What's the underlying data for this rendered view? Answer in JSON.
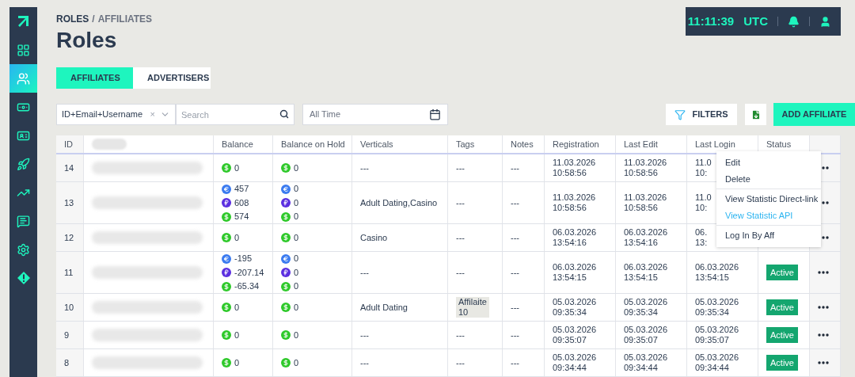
{
  "sidebar": {
    "items": [
      {
        "kind": "dashboard",
        "selected": false
      },
      {
        "kind": "users",
        "selected": true
      },
      {
        "kind": "money",
        "selected": false
      },
      {
        "kind": "card",
        "selected": false
      },
      {
        "kind": "rocket",
        "selected": false
      },
      {
        "kind": "chart",
        "selected": false
      },
      {
        "kind": "message",
        "selected": false
      },
      {
        "kind": "settings",
        "selected": false
      },
      {
        "kind": "alert",
        "selected": false
      }
    ]
  },
  "breadcrumb": {
    "parent": "ROLES",
    "separator": "/",
    "current": "AFFILIATES"
  },
  "title": "Roles",
  "topbar": {
    "time": "11:11:39",
    "zone": "UTC"
  },
  "tabs": [
    {
      "label": "AFFILIATES",
      "selected": true
    },
    {
      "label": "ADVERTISERS",
      "selected": false
    }
  ],
  "search_by": {
    "value": "ID+Email+Username",
    "clear": "×"
  },
  "search": {
    "placeholder": "Search"
  },
  "period": {
    "value": "All Time"
  },
  "filters_button": "FILTERS",
  "add_button": "ADD AFFILIATE",
  "table": {
    "columns": [
      "ID",
      "Balance",
      "Balance on Hold",
      "Verticals",
      "Tags",
      "Notes",
      "Registration",
      "Last Edit",
      "Last Login",
      "Status"
    ],
    "rows": [
      {
        "id": "14",
        "balance": [
          {
            "kind": "usd",
            "amount": "0"
          }
        ],
        "hold": [
          {
            "kind": "usd",
            "amount": "0"
          }
        ],
        "verticals": "---",
        "tags": {
          "kind": "plain",
          "text": "---"
        },
        "notes": "---",
        "registration": {
          "date": "11.03.2026",
          "time": "10:58:56"
        },
        "last_edit": {
          "date": "11.03.2026",
          "time": "10:58:56"
        },
        "last_login": {
          "date": "11.0",
          "time": "10:"
        }
      },
      {
        "id": "13",
        "balance": [
          {
            "kind": "eur",
            "amount": "457"
          },
          {
            "kind": "rub",
            "amount": "608"
          },
          {
            "kind": "usd",
            "amount": "574"
          }
        ],
        "hold": [
          {
            "kind": "eur",
            "amount": "0"
          },
          {
            "kind": "rub",
            "amount": "0"
          },
          {
            "kind": "usd",
            "amount": "0"
          }
        ],
        "verticals": "Adult Dating,Casino",
        "tags": {
          "kind": "plain",
          "text": "---"
        },
        "notes": "---",
        "registration": {
          "date": "11.03.2026",
          "time": "10:58:56"
        },
        "last_edit": {
          "date": "11.03.2026",
          "time": "10:58:56"
        },
        "last_login": {
          "date": "11.0",
          "time": "10:"
        }
      },
      {
        "id": "12",
        "balance": [
          {
            "kind": "usd",
            "amount": "0"
          }
        ],
        "hold": [
          {
            "kind": "usd",
            "amount": "0"
          }
        ],
        "verticals": "Casino",
        "tags": {
          "kind": "plain",
          "text": "---"
        },
        "notes": "---",
        "registration": {
          "date": "06.03.2026",
          "time": "13:54:16"
        },
        "last_edit": {
          "date": "06.03.2026",
          "time": "13:54:16"
        },
        "last_login": {
          "date": "06.",
          "time": "13:"
        }
      },
      {
        "id": "11",
        "balance": [
          {
            "kind": "eur",
            "amount": "-195"
          },
          {
            "kind": "rub",
            "amount": "-207.14"
          },
          {
            "kind": "usd",
            "amount": "-65.34"
          }
        ],
        "hold": [
          {
            "kind": "eur",
            "amount": "0"
          },
          {
            "kind": "rub",
            "amount": "0"
          },
          {
            "kind": "usd",
            "amount": "0"
          }
        ],
        "verticals": "---",
        "tags": {
          "kind": "plain",
          "text": "---"
        },
        "notes": "---",
        "registration": {
          "date": "06.03.2026",
          "time": "13:54:15"
        },
        "last_edit": {
          "date": "06.03.2026",
          "time": "13:54:15"
        },
        "last_login": {
          "date": "06.03.2026",
          "time": "13:54:15"
        },
        "status": "Active"
      },
      {
        "id": "10",
        "balance": [
          {
            "kind": "usd",
            "amount": "0"
          }
        ],
        "hold": [
          {
            "kind": "usd",
            "amount": "0"
          }
        ],
        "verticals": "Adult Dating",
        "tags": {
          "kind": "chip",
          "text": "Affilaite 10"
        },
        "notes": "---",
        "registration": {
          "date": "05.03.2026",
          "time": "09:35:34"
        },
        "last_edit": {
          "date": "05.03.2026",
          "time": "09:35:34"
        },
        "last_login": {
          "date": "05.03.2026",
          "time": "09:35:34"
        },
        "status": "Active"
      },
      {
        "id": "9",
        "balance": [
          {
            "kind": "usd",
            "amount": "0"
          }
        ],
        "hold": [
          {
            "kind": "usd",
            "amount": "0"
          }
        ],
        "verticals": "---",
        "tags": {
          "kind": "plain",
          "text": "---"
        },
        "notes": "---",
        "registration": {
          "date": "05.03.2026",
          "time": "09:35:07"
        },
        "last_edit": {
          "date": "05.03.2026",
          "time": "09:35:07"
        },
        "last_login": {
          "date": "05.03.2026",
          "time": "09:35:07"
        },
        "status": "Active"
      },
      {
        "id": "8",
        "balance": [
          {
            "kind": "usd",
            "amount": "0"
          }
        ],
        "hold": [
          {
            "kind": "usd",
            "amount": "0"
          }
        ],
        "verticals": "---",
        "tags": {
          "kind": "plain",
          "text": "---"
        },
        "notes": "---",
        "registration": {
          "date": "05.03.2026",
          "time": "09:34:44"
        },
        "last_edit": {
          "date": "05.03.2026",
          "time": "09:34:44"
        },
        "last_login": {
          "date": "05.03.2026",
          "time": "09:34:44"
        },
        "status": "Active"
      }
    ]
  },
  "row_menu": {
    "groups": [
      [
        {
          "label": "Edit",
          "selected": false
        },
        {
          "label": "Delete",
          "selected": false
        }
      ],
      [
        {
          "label": "View Statistic Direct-link",
          "selected": false
        },
        {
          "label": "View Statistic API",
          "selected": true
        }
      ],
      [
        {
          "label": "Log In By Aff",
          "selected": false
        }
      ]
    ]
  }
}
